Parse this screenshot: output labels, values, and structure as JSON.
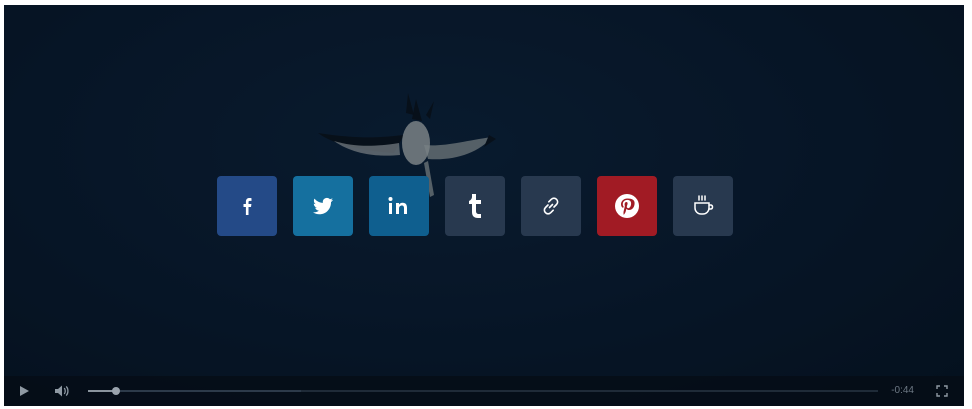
{
  "player": {
    "time_remaining": "-0:44",
    "progress_played": 0.036,
    "progress_buffered": 0.27
  },
  "share_buttons": [
    {
      "id": "facebook",
      "icon": "facebook-icon",
      "color": "#244a87"
    },
    {
      "id": "twitter",
      "icon": "twitter-icon",
      "color": "#15709f"
    },
    {
      "id": "linkedin",
      "icon": "linkedin-icon",
      "color": "#0f5f8f"
    },
    {
      "id": "tumblr",
      "icon": "tumblr-icon",
      "color": "#28394f"
    },
    {
      "id": "link",
      "icon": "link-icon",
      "color": "#28394f"
    },
    {
      "id": "pinterest",
      "icon": "pinterest-icon",
      "color": "#a11b24"
    },
    {
      "id": "coffee",
      "icon": "coffee-cup-icon",
      "color": "#28394f"
    }
  ]
}
